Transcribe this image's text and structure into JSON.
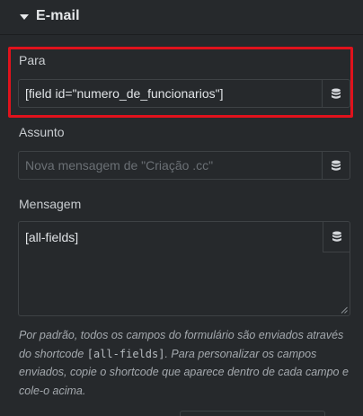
{
  "section": {
    "title": "E-mail"
  },
  "fields": {
    "to": {
      "label": "Para",
      "value": "[field id=\"numero_de_funcionarios\"]"
    },
    "subject": {
      "label": "Assunto",
      "placeholder": "Nova mensagem de \"Criação .cc\""
    },
    "message": {
      "label": "Mensagem",
      "value": "[all-fields]"
    }
  },
  "help": {
    "part1": "Por padrão, todos os campos do formulário são enviados através do shortcode ",
    "code": "[all-fields]",
    "part2": ". Para personalizar os campos enviados, copie o shortcode que aparece dentro de cada campo e cole-o acima."
  },
  "icons": {
    "dynamic_tags": "database-icon",
    "section_toggle": "caret-down-icon"
  },
  "colors": {
    "background": "#26292c",
    "highlight": "#e0121c"
  }
}
